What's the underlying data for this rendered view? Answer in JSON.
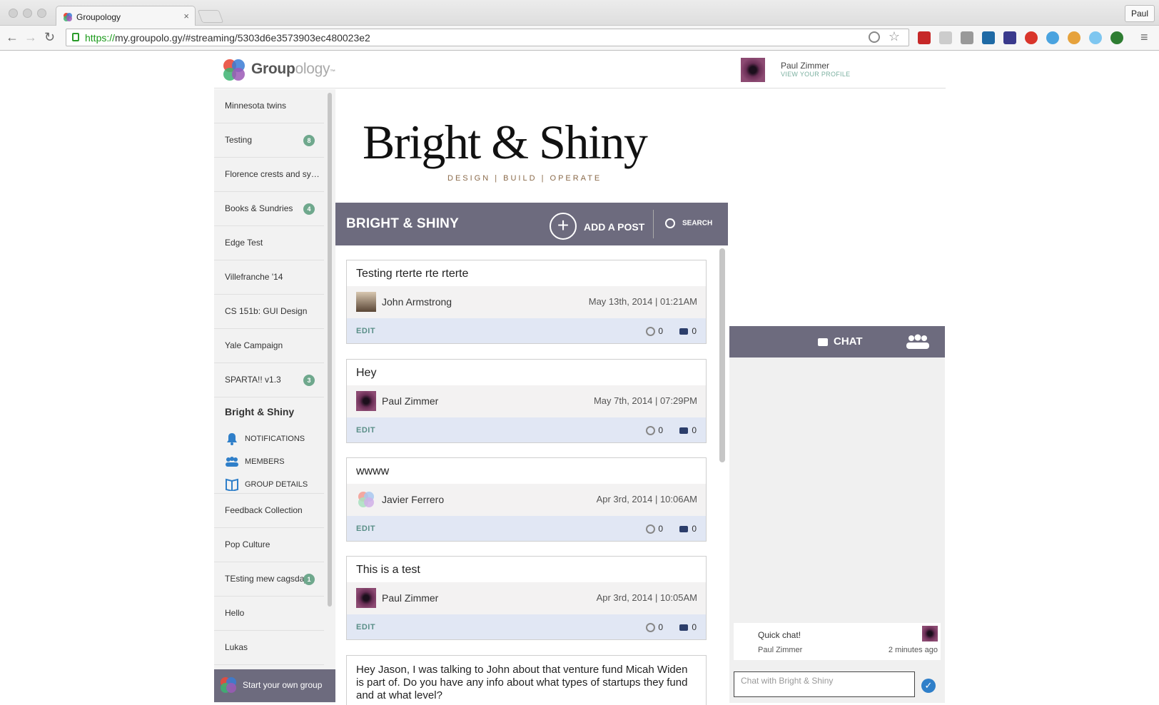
{
  "browser": {
    "tab_title": "Groupology",
    "tab_close": "×",
    "user": "Paul",
    "url_https": "https://",
    "url_rest": "my.groupolo.gy/#streaming/5303d6e3573903ec480023e2",
    "back": "←",
    "forward": "→",
    "reload": "↻",
    "menu": "≡"
  },
  "header": {
    "logo_bold": "Group",
    "logo_light": "ology",
    "logo_tm": "™",
    "profile_name": "Paul Zimmer",
    "profile_link": "VIEW YOUR PROFILE"
  },
  "sidebar": {
    "items": [
      {
        "label": "Minnesota twins",
        "badge": ""
      },
      {
        "label": "Testing",
        "badge": "8"
      },
      {
        "label": "Florence crests and sy…",
        "badge": ""
      },
      {
        "label": "Books & Sundries",
        "badge": "4"
      },
      {
        "label": "Edge Test",
        "badge": ""
      },
      {
        "label": "Villefranche '14",
        "badge": ""
      },
      {
        "label": "CS 151b: GUI Design",
        "badge": ""
      },
      {
        "label": "Yale Campaign",
        "badge": ""
      },
      {
        "label": "SPARTA!! v1.3",
        "badge": "3"
      }
    ],
    "active_group": "Bright & Shiny",
    "sub_items": {
      "notifications": "NOTIFICATIONS",
      "members": "MEMBERS",
      "details": "GROUP DETAILS"
    },
    "more_items": [
      {
        "label": "Feedback Collection",
        "badge": ""
      },
      {
        "label": "Pop Culture",
        "badge": ""
      },
      {
        "label": "TEsting mew cagsdaj",
        "badge": "1"
      },
      {
        "label": "Hello",
        "badge": ""
      },
      {
        "label": "Lukas",
        "badge": ""
      }
    ],
    "start_group": "Start your own group"
  },
  "brand": {
    "title": "Bright & Shiny",
    "subtitle": "DESIGN | BUILD | OPERATE"
  },
  "group_bar": {
    "title": "BRIGHT & SHINY",
    "add_post": "ADD A POST",
    "plus": "+",
    "search": "SEARCH"
  },
  "posts": [
    {
      "title": "Testing rterte rte rterte",
      "author": "John Armstrong",
      "date": "May 13th, 2014 | 01:21AM",
      "edit": "EDIT",
      "likes": "0",
      "comments": "0"
    },
    {
      "title": "Hey",
      "author": "Paul Zimmer",
      "date": "May 7th, 2014 | 07:29PM",
      "edit": "EDIT",
      "likes": "0",
      "comments": "0"
    },
    {
      "title": "wwww",
      "author": "Javier Ferrero",
      "date": "Apr 3rd, 2014 | 10:06AM",
      "edit": "EDIT",
      "likes": "0",
      "comments": "0"
    },
    {
      "title": "This is a test",
      "author": "Paul Zimmer",
      "date": "Apr 3rd, 2014 | 10:05AM",
      "edit": "EDIT",
      "likes": "0",
      "comments": "0"
    }
  ],
  "long_post": "Hey Jason, I was talking to John about that venture fund Micah Widen is part of. Do you have any info about what types of startups they fund and at what level?",
  "chat": {
    "label": "CHAT",
    "message": "Quick chat!",
    "message_author": "Paul Zimmer",
    "message_time": "2 minutes ago",
    "input_placeholder": "Chat with Bright & Shiny",
    "send": "✓"
  }
}
